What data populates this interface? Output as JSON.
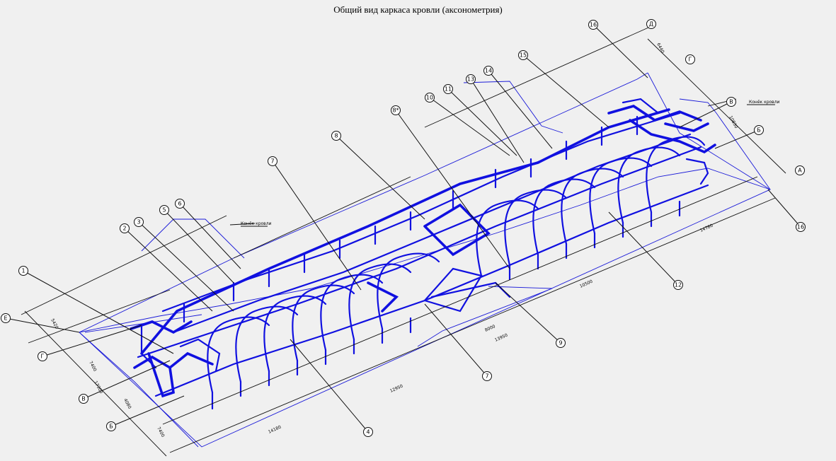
{
  "title": "Общий вид каркаса кровли (аксонометрия)",
  "colors": {
    "background": "#f0f0f0",
    "frame": "#1010e0",
    "lines": "#111111"
  },
  "callouts": [
    "1",
    "2",
    "3",
    "4",
    "5",
    "6",
    "7",
    "7",
    "8",
    "8*",
    "9",
    "10",
    "11",
    "12",
    "13",
    "14",
    "15",
    "16",
    "16"
  ],
  "axis_labels": [
    "Е",
    "Г",
    "В",
    "Б",
    "Д",
    "Г",
    "В",
    "Б",
    "А"
  ],
  "dimensions": [
    "5420",
    "7400",
    "17300",
    "4080",
    "7400",
    "14180",
    "12950",
    "13950",
    "8000",
    "10500",
    "14780",
    "6440",
    "10830"
  ],
  "notes": [
    "Конёк кровли",
    "Конёк кровли"
  ]
}
